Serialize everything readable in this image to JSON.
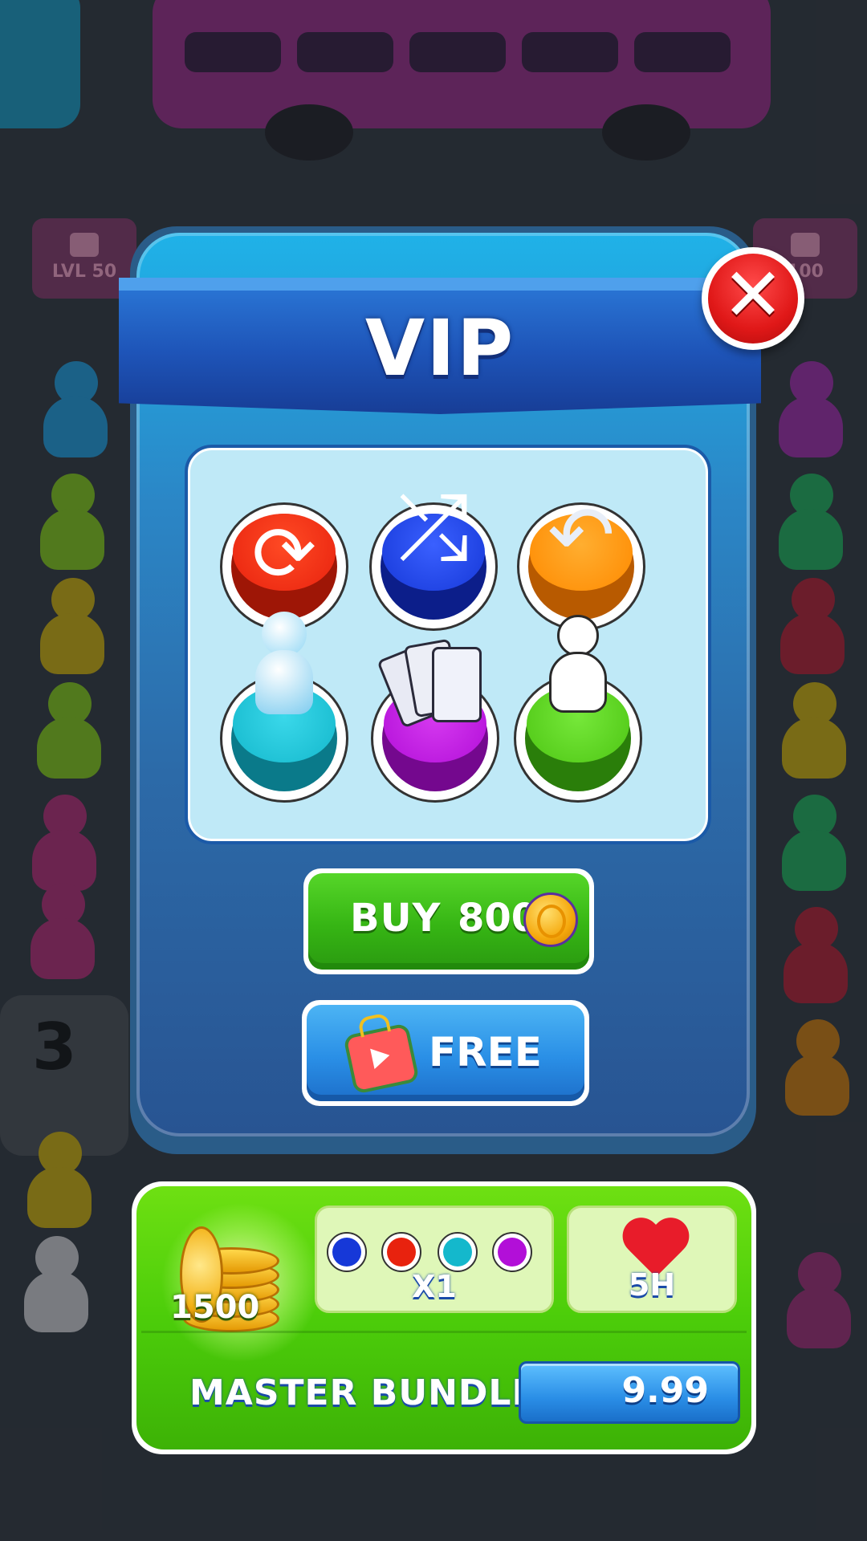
{
  "background": {
    "locked_left_label": "LVL 50",
    "locked_right_label": "100",
    "slot_number": "3"
  },
  "dialog": {
    "title": "VIP",
    "close_icon": "close-x-icon",
    "boosters": [
      {
        "name": "refresh",
        "icon": "refresh-icon",
        "color": "#e8220e"
      },
      {
        "name": "shuffle",
        "icon": "shuffle-icon",
        "color": "#1638d8"
      },
      {
        "name": "undo",
        "icon": "undo-icon",
        "color": "#ff8a00"
      },
      {
        "name": "freeze",
        "icon": "frozen-figure-icon",
        "color": "#14b8cc"
      },
      {
        "name": "cards",
        "icon": "cards-icon",
        "color": "#b20fd8"
      },
      {
        "name": "extra-person",
        "icon": "person-icon",
        "color": "#4ec614"
      }
    ],
    "buy_button": {
      "label": "BUY",
      "amount": "800",
      "currency_icon": "coin-icon"
    },
    "free_button": {
      "label": "FREE",
      "icon": "video-ad-icon"
    }
  },
  "bundle": {
    "coins": "1500",
    "booster_count": "X1",
    "booster_icons": [
      "shuffle-icon",
      "refresh-icon",
      "frozen-figure-icon",
      "cards-icon"
    ],
    "lives": "5H",
    "name": "MASTER BUNDLE",
    "price": "9.99"
  },
  "colors": {
    "panel_top": "#1fb2e8",
    "panel_bottom": "#285492",
    "banner": "#1e54b8",
    "buy_green": "#36b514",
    "free_blue": "#2a8fe6",
    "close_red": "#e01818",
    "bundle_green": "#4ccd0a"
  }
}
